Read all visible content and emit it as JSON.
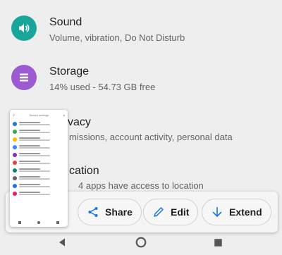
{
  "settings": [
    {
      "title": "Sound",
      "subtitle": "Volume, vibration, Do Not Disturb",
      "icon": "volume-icon",
      "color": "#1aa59a"
    },
    {
      "title": "Storage",
      "subtitle": "14% used - 54.73 GB free",
      "icon": "storage-icon",
      "color": "#9c5bd0"
    },
    {
      "title": "Privacy",
      "title_visible": "vacy",
      "subtitle_visible": "missions, account activity, personal data",
      "icon": "privacy-icon"
    },
    {
      "title": "Location",
      "title_visible": "cation",
      "subtitle_visible": "4 apps have access to location",
      "icon": "location-icon"
    }
  ],
  "screenshot_preview": {
    "label": "Search settings",
    "item_colors": [
      "#1a73e8",
      "#34a853",
      "#fbbc04",
      "#4285f4",
      "#9c27b0",
      "#ea4335",
      "#00897b",
      "#5f6368",
      "#1a73e8",
      "#e91e63"
    ]
  },
  "actions": {
    "share_label": "Share",
    "edit_label": "Edit",
    "extend_label": "Extend",
    "accent": "#1a73e8"
  },
  "navbar": {
    "back_icon": "back-icon",
    "home_icon": "home-icon",
    "recents_icon": "recents-icon"
  }
}
